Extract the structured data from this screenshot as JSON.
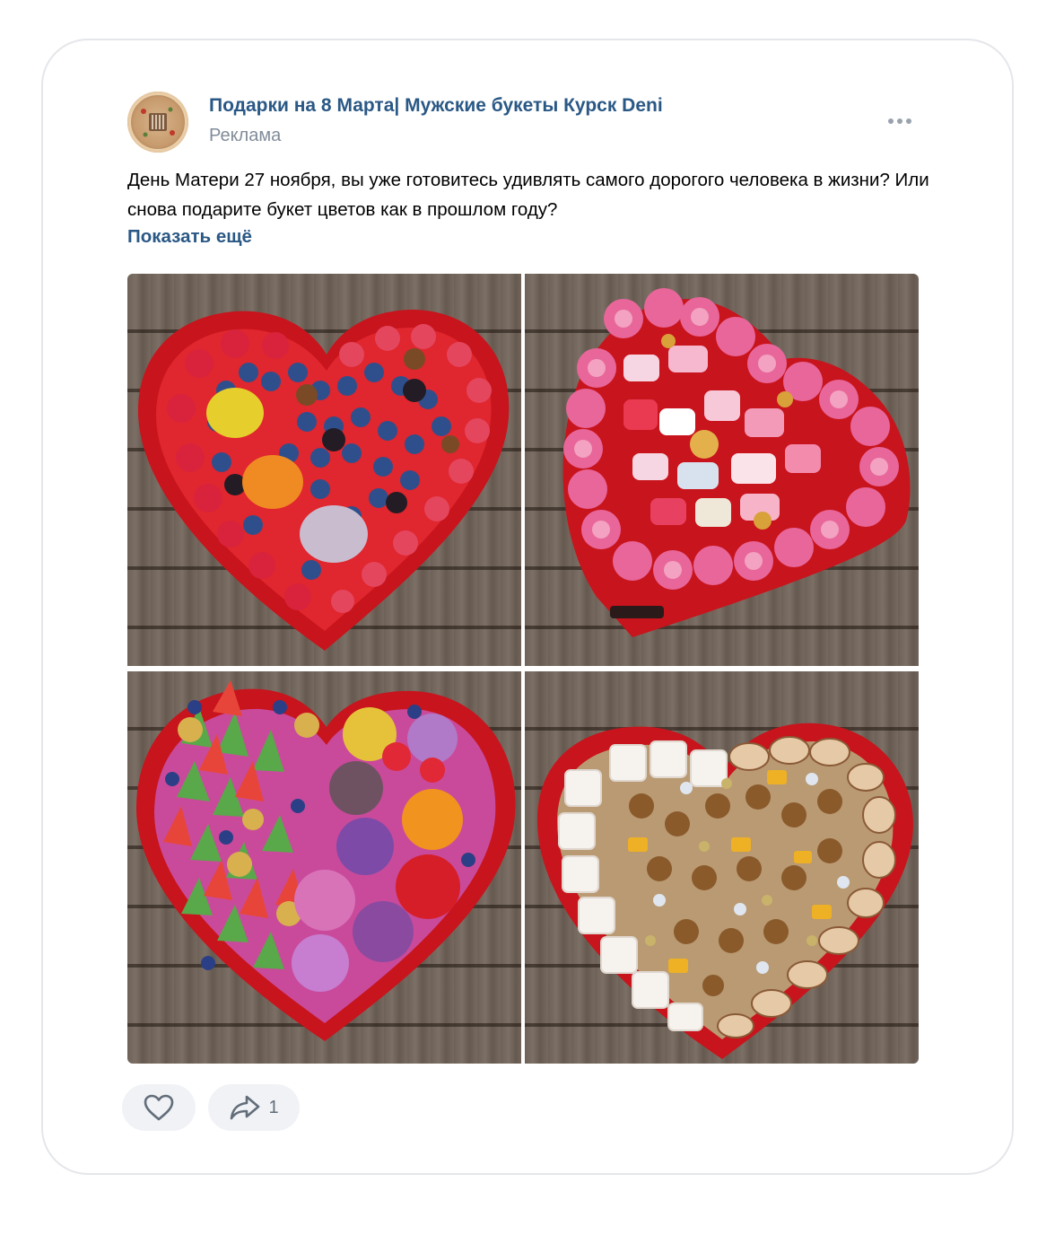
{
  "post": {
    "author": "Подарки на 8 Марта| Мужские букеты Курск Deni",
    "label": "Реклама",
    "text": "День Матери 27 ноября, вы уже готовитесь удивлять самого дорогого человека в жизни? Или снова подарите букет цветов как в прошлом году?",
    "show_more": "Показать ещё",
    "photos": [
      {
        "icon": "heart-box-berries-macarons-image"
      },
      {
        "icon": "heart-box-roses-marshmallow-image"
      },
      {
        "icon": "heart-box-cheese-flowers-image"
      },
      {
        "icon": "heart-box-nuts-dried-fruit-image"
      }
    ]
  },
  "actions": {
    "like": {
      "icon": "heart-icon"
    },
    "share": {
      "icon": "share-icon",
      "count": "1"
    }
  },
  "colors": {
    "link": "#2a5885",
    "secondary": "#818c99",
    "button_bg": "#f0f2f5",
    "box_red": "#d81f26"
  }
}
